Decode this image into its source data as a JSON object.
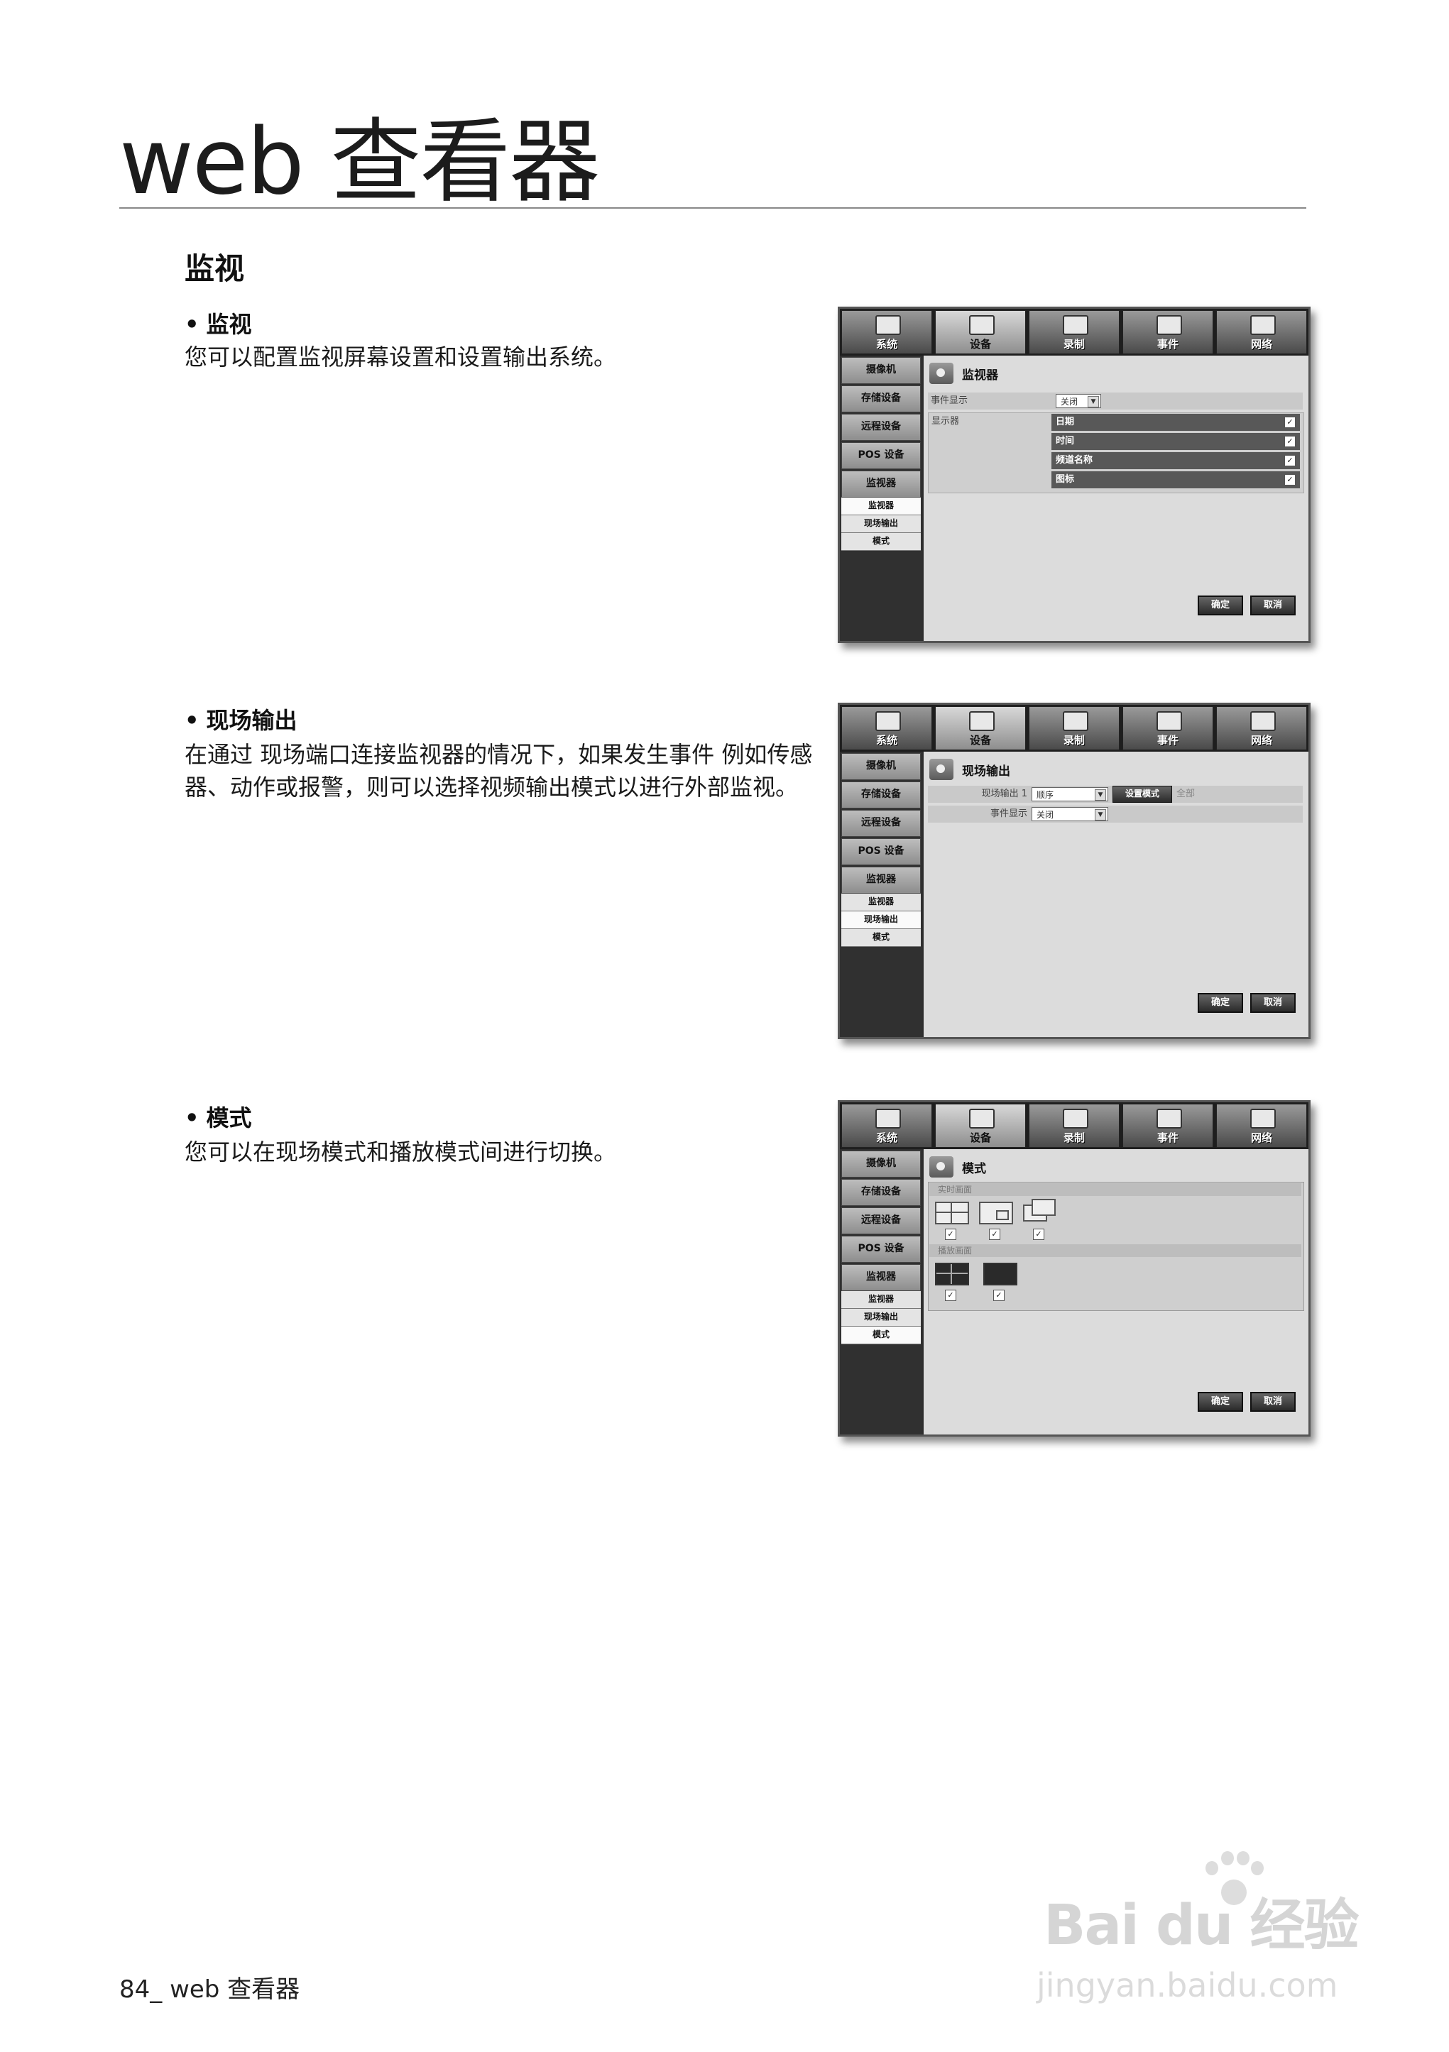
{
  "page": {
    "title": "web 查看器",
    "section": "监视",
    "footer": "84_ web 查看器"
  },
  "items": [
    {
      "heading": "监视",
      "bullet": "•",
      "desc": "您可以配置监视屏幕设置和设置输出系统。"
    },
    {
      "heading": "现场输出",
      "bullet": "•",
      "desc": "在通过 现场端口连接监视器的情况下，如果发生事件 例如传感器、动作或报警，则可以选择视频输出模式以进行外部监视。"
    },
    {
      "heading": "模式",
      "bullet": "•",
      "desc": "您可以在现场模式和播放模式间进行切换。"
    }
  ],
  "dvr": {
    "tabs": [
      "系统",
      "设备",
      "录制",
      "事件",
      "网络"
    ],
    "side": [
      "摄像机",
      "存储设备",
      "远程设备",
      "POS 设备",
      "监视器"
    ],
    "sub": [
      "监视器",
      "现场输出",
      "模式"
    ],
    "ok": "确定",
    "cancel": "取消"
  },
  "panel1": {
    "title": "监视器",
    "event_label": "事件显示",
    "event_value": "关闭",
    "display_label": "显示器",
    "rows": [
      "日期",
      "时间",
      "频道名称",
      "图标"
    ]
  },
  "panel2": {
    "title": "现场输出",
    "out_label": "现场输出 1",
    "out_value": "顺序",
    "mode_btn": "设置模式",
    "all_label": "全部",
    "event_label": "事件显示",
    "event_value": "关闭"
  },
  "panel3": {
    "title": "模式",
    "live_label": "实时画面",
    "play_label": "播放画面"
  },
  "watermark": {
    "logo": "Bai du 经验",
    "url": "jingyan.baidu.com"
  }
}
